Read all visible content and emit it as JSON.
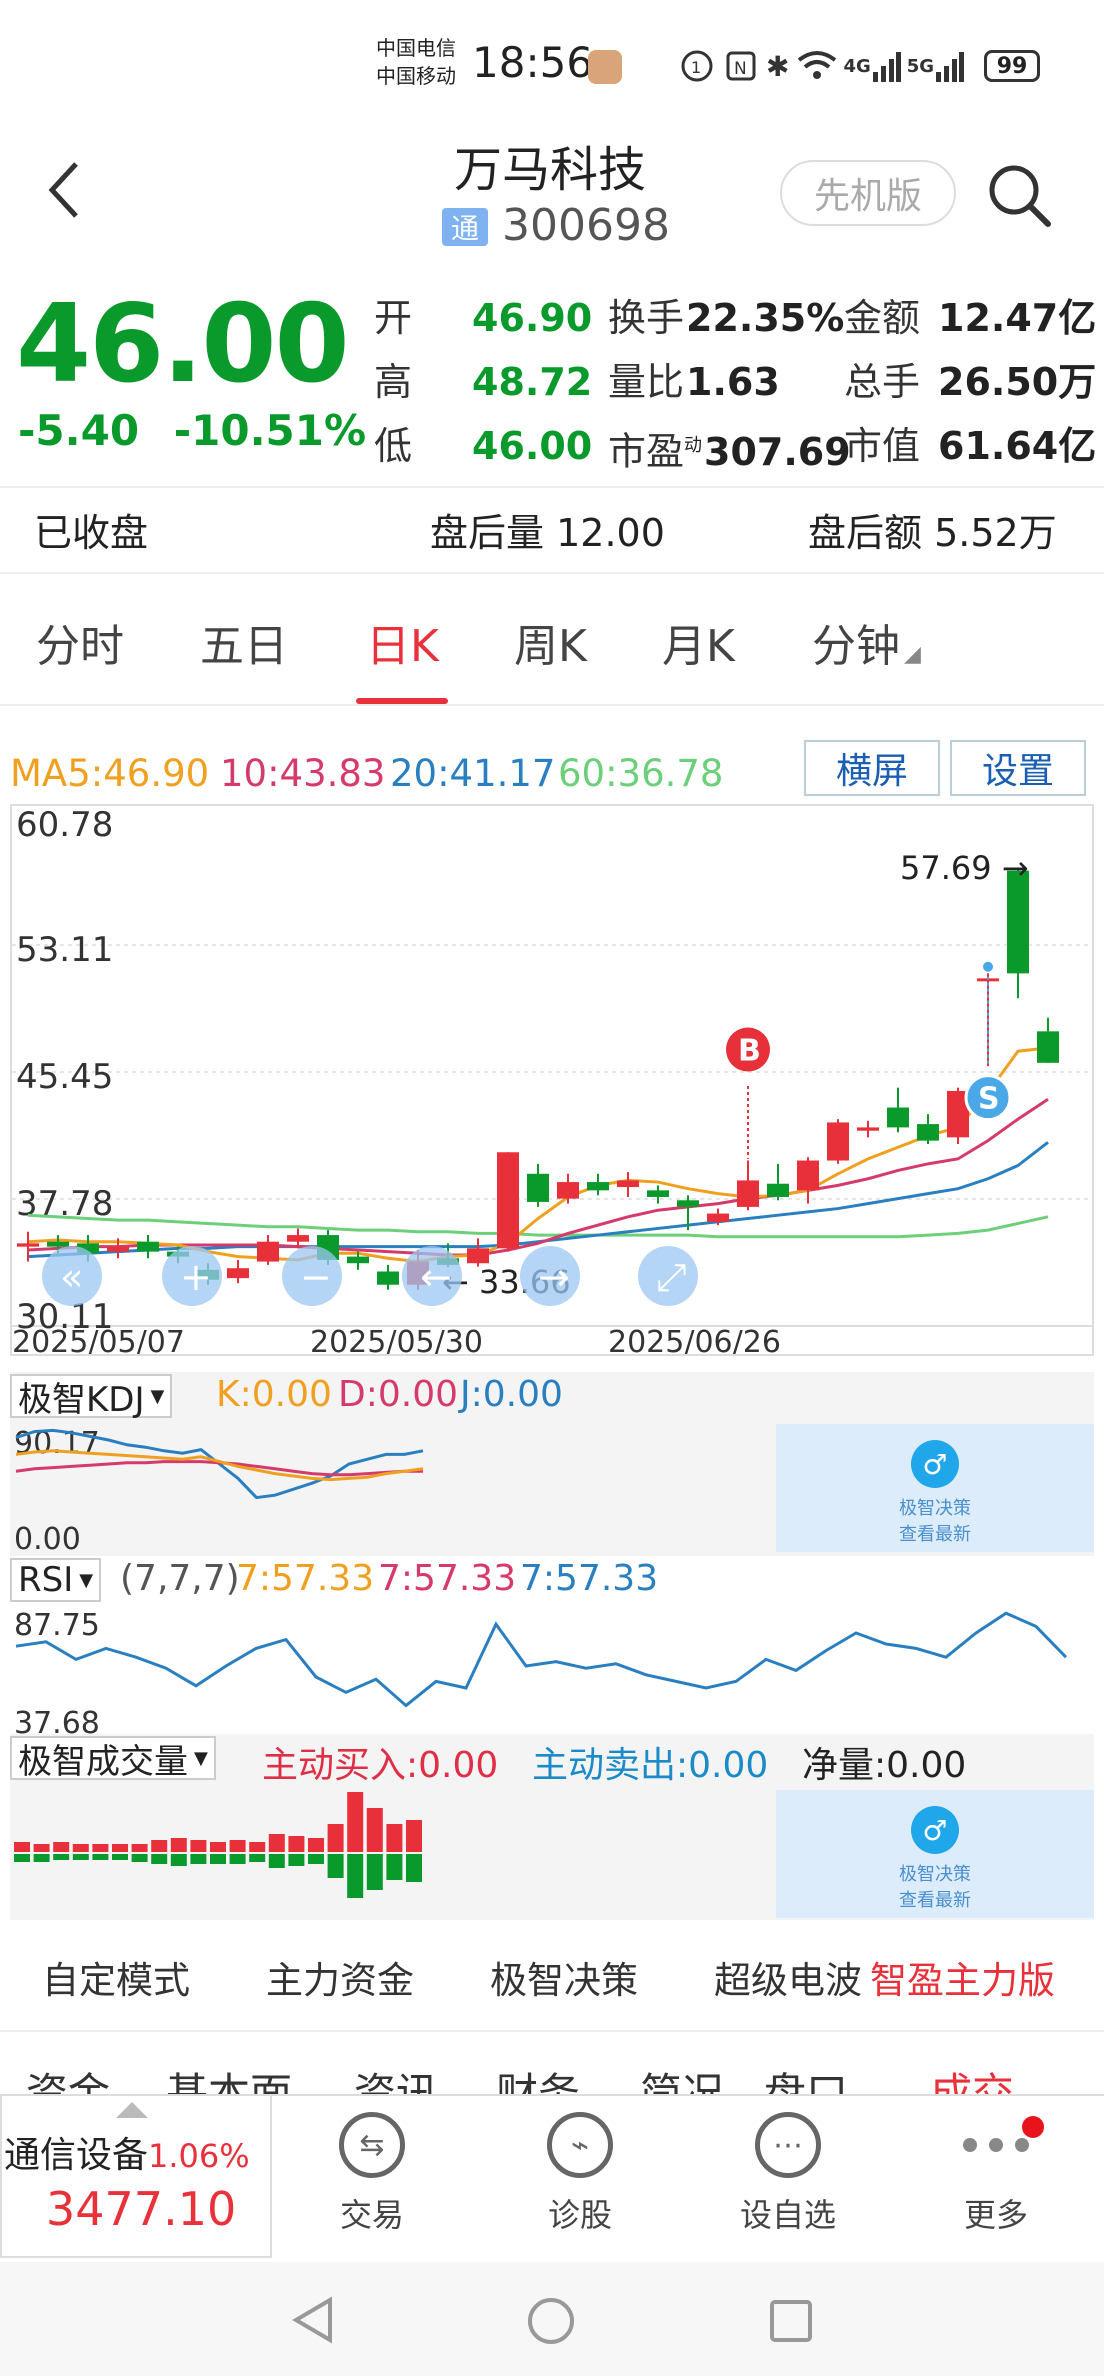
{
  "status_bar": {
    "carrier1": "中国电信",
    "carrier2": "中国移动",
    "time": "18:56",
    "network1": "4G",
    "network2": "5G",
    "battery": "99"
  },
  "header": {
    "title": "万马科技",
    "tag": "通",
    "code": "300698",
    "version_button": "先机版"
  },
  "quote": {
    "price": "46.00",
    "change": "-5.40",
    "change_pct": "-10.51%",
    "rows": [
      [
        {
          "l": "开",
          "v": "46.90",
          "c": "g"
        },
        {
          "l": "换手",
          "v": "22.35%",
          "c": "k"
        },
        {
          "l": "金额",
          "v": "12.47亿",
          "c": "k"
        }
      ],
      [
        {
          "l": "高",
          "v": "48.72",
          "c": "g"
        },
        {
          "l": "量比",
          "v": "1.63",
          "c": "k"
        },
        {
          "l": "总手",
          "v": "26.50万",
          "c": "k"
        }
      ],
      [
        {
          "l": "低",
          "v": "46.00",
          "c": "g"
        },
        {
          "l": "市盈",
          "v": "307.69",
          "c": "k"
        },
        {
          "l": "市值",
          "v": "61.64亿",
          "c": "k"
        }
      ]
    ],
    "pe_sup": "动",
    "closed": "已收盘",
    "after_vol_label": "盘后量",
    "after_vol": "12.00",
    "after_amt_label": "盘后额",
    "after_amt": "5.52万"
  },
  "tabs": [
    "分时",
    "五日",
    "日K",
    "周K",
    "月K",
    "分钟"
  ],
  "active_tab": "日K",
  "ma_legend": {
    "ma5": "MA5:46.90",
    "ma10": "10:43.83",
    "ma20": "20:41.17",
    "ma60": "60:36.78",
    "colors": {
      "ma5": "#f0a020",
      "ma10": "#d63a6a",
      "ma20": "#2a7fc0",
      "ma60": "#6ccf7a"
    }
  },
  "chart_buttons": {
    "landscape": "横屏",
    "settings": "设置"
  },
  "chart_data": {
    "type": "candlestick",
    "y_labels": [
      "60.78",
      "53.11",
      "45.45",
      "37.78",
      "30.11"
    ],
    "ylim": [
      30.11,
      60.78
    ],
    "x_labels": [
      "2025/05/07",
      "2025/05/30",
      "2025/06/26"
    ],
    "high_label": "57.69",
    "low_label": "33.66",
    "buy_marker": "B",
    "sell_marker": "S",
    "candles": [
      {
        "o": 34.9,
        "c": 35.1,
        "h": 35.8,
        "l": 34.0
      },
      {
        "o": 35.2,
        "c": 34.9,
        "h": 35.6,
        "l": 34.3
      },
      {
        "o": 35.1,
        "c": 34.5,
        "h": 35.6,
        "l": 34.0
      },
      {
        "o": 34.6,
        "c": 34.9,
        "h": 35.4,
        "l": 34.2
      },
      {
        "o": 35.2,
        "c": 34.6,
        "h": 35.6,
        "l": 34.2
      },
      {
        "o": 34.6,
        "c": 34.3,
        "h": 34.9,
        "l": 33.9
      },
      {
        "o": 33.5,
        "c": 32.9,
        "h": 33.9,
        "l": 32.6
      },
      {
        "o": 33.0,
        "c": 33.6,
        "h": 34.1,
        "l": 32.7
      },
      {
        "o": 34.0,
        "c": 35.2,
        "h": 35.6,
        "l": 33.8
      },
      {
        "o": 35.2,
        "c": 35.6,
        "h": 36.0,
        "l": 34.8
      },
      {
        "o": 35.6,
        "c": 34.1,
        "h": 35.9,
        "l": 33.8
      },
      {
        "o": 34.3,
        "c": 33.9,
        "h": 34.6,
        "l": 33.5
      },
      {
        "o": 33.4,
        "c": 32.6,
        "h": 33.8,
        "l": 32.3
      },
      {
        "o": 32.6,
        "c": 34.0,
        "h": 34.7,
        "l": 32.3
      },
      {
        "o": 34.2,
        "c": 33.8,
        "h": 35.1,
        "l": 33.66
      },
      {
        "o": 33.9,
        "c": 34.8,
        "h": 35.4,
        "l": 33.7
      },
      {
        "o": 34.8,
        "c": 40.6,
        "h": 40.6,
        "l": 34.6
      },
      {
        "o": 39.3,
        "c": 37.6,
        "h": 39.9,
        "l": 37.3
      },
      {
        "o": 37.8,
        "c": 38.8,
        "h": 39.3,
        "l": 37.5
      },
      {
        "o": 38.8,
        "c": 38.3,
        "h": 39.3,
        "l": 38.0
      },
      {
        "o": 38.5,
        "c": 38.9,
        "h": 39.4,
        "l": 37.9
      },
      {
        "o": 38.3,
        "c": 37.9,
        "h": 38.6,
        "l": 37.5
      },
      {
        "o": 37.7,
        "c": 37.3,
        "h": 38.0,
        "l": 35.9
      },
      {
        "o": 36.4,
        "c": 36.9,
        "h": 37.2,
        "l": 36.2
      },
      {
        "o": 37.3,
        "c": 38.9,
        "h": 40.1,
        "l": 37.1
      },
      {
        "o": 38.7,
        "c": 37.9,
        "h": 39.9,
        "l": 37.7
      },
      {
        "o": 38.3,
        "c": 40.1,
        "h": 40.3,
        "l": 37.5
      },
      {
        "o": 40.1,
        "c": 42.4,
        "h": 42.6,
        "l": 39.9
      },
      {
        "o": 41.9,
        "c": 42.1,
        "h": 42.5,
        "l": 41.5
      },
      {
        "o": 43.3,
        "c": 42.1,
        "h": 44.5,
        "l": 41.8
      },
      {
        "o": 42.3,
        "c": 41.3,
        "h": 42.9,
        "l": 41.1
      },
      {
        "o": 41.5,
        "c": 44.3,
        "h": 44.5,
        "l": 41.1
      },
      {
        "o": 51.1,
        "c": 51.1,
        "h": 51.4,
        "l": 45.8
      },
      {
        "o": 57.6,
        "c": 51.4,
        "h": 57.69,
        "l": 49.9
      },
      {
        "o": 47.9,
        "c": 46.0,
        "h": 48.72,
        "l": 46.0
      }
    ],
    "ma5": [
      35.2,
      35.3,
      35.2,
      35.2,
      35.1,
      35.0,
      34.6,
      34.3,
      34.2,
      34.1,
      34.5,
      34.5,
      34.2,
      34.0,
      34.3,
      34.4,
      35.1,
      36.6,
      37.9,
      38.6,
      38.9,
      38.8,
      38.4,
      38.1,
      37.9,
      38.0,
      38.3,
      39.3,
      40.2,
      40.9,
      41.6,
      42.1,
      44.2,
      46.7,
      46.9
    ],
    "ma10": [
      34.7,
      34.8,
      34.9,
      34.9,
      35.0,
      35.0,
      35.0,
      35.0,
      35.0,
      34.9,
      34.8,
      34.7,
      34.6,
      34.5,
      34.4,
      34.4,
      34.7,
      35.1,
      35.7,
      36.2,
      36.7,
      37.1,
      37.3,
      37.5,
      37.8,
      38.0,
      38.3,
      38.6,
      39.0,
      39.5,
      39.9,
      40.2,
      41.3,
      42.6,
      43.8
    ],
    "ma20": [
      34.3,
      34.4,
      34.5,
      34.6,
      34.7,
      34.8,
      34.8,
      34.9,
      34.9,
      34.9,
      34.9,
      34.9,
      34.9,
      34.9,
      34.9,
      34.9,
      35.0,
      35.2,
      35.4,
      35.6,
      35.8,
      36.0,
      36.2,
      36.4,
      36.6,
      36.8,
      37.0,
      37.2,
      37.5,
      37.8,
      38.1,
      38.4,
      39.0,
      39.8,
      41.2
    ],
    "ma60": [
      36.8,
      36.7,
      36.6,
      36.5,
      36.5,
      36.4,
      36.3,
      36.2,
      36.1,
      36.1,
      36.0,
      35.9,
      35.9,
      35.8,
      35.8,
      35.7,
      35.7,
      35.6,
      35.6,
      35.6,
      35.6,
      35.6,
      35.6,
      35.5,
      35.5,
      35.5,
      35.5,
      35.5,
      35.5,
      35.5,
      35.6,
      35.7,
      35.9,
      36.3,
      36.7
    ],
    "visible_dates": 35
  },
  "kdj": {
    "name": "极智KDJ",
    "k": "K:0.00",
    "d": "D:0.00",
    "j": "J:0.00",
    "top": "90.17",
    "bottom": "0.00",
    "k_vals": [
      78,
      80,
      81,
      80,
      79,
      78,
      77,
      76,
      75,
      74,
      76,
      72,
      68,
      65,
      62,
      60,
      58,
      57,
      58,
      59,
      62,
      64,
      66
    ],
    "d_vals": [
      64,
      66,
      67,
      68,
      69,
      70,
      71,
      71,
      72,
      72,
      72,
      71,
      70,
      68,
      66,
      64,
      62,
      61,
      61,
      62,
      63,
      64,
      64
    ],
    "j_vals": [
      92,
      97,
      98,
      96,
      93,
      90,
      86,
      84,
      81,
      79,
      82,
      70,
      58,
      42,
      44,
      49,
      54,
      60,
      70,
      74,
      78,
      78,
      81
    ]
  },
  "rsi": {
    "name": "RSI",
    "params": "(7,7,7)",
    "v1": "7:57.33",
    "v2": "7:57.33",
    "v3": "7:57.33",
    "top": "87.75",
    "bottom": "37.68",
    "vals": [
      76,
      78,
      70,
      75,
      71,
      66,
      58,
      67,
      75,
      79,
      62,
      55,
      61,
      49,
      60,
      57,
      86,
      67,
      69,
      66,
      68,
      63,
      60,
      57,
      60,
      70,
      65,
      74,
      82,
      77,
      75,
      71,
      82,
      91,
      85,
      71
    ]
  },
  "volume": {
    "name": "极智成交量",
    "buy": "主动买入:0.00",
    "sell": "主动卖出:0.00",
    "net": "净量:0.00",
    "up": [
      5,
      4,
      5,
      4,
      4,
      4,
      4,
      6,
      7,
      6,
      5,
      6,
      5,
      9,
      8,
      7,
      14,
      30,
      22,
      14,
      16
    ],
    "down": [
      4,
      4,
      3,
      3,
      3,
      3,
      4,
      5,
      6,
      5,
      5,
      5,
      4,
      7,
      6,
      5,
      12,
      22,
      18,
      13,
      14
    ]
  },
  "promo": {
    "line1": "极智决策",
    "line2": "查看最新"
  },
  "modes": [
    "自定模式",
    "主力资金",
    "极智决策",
    "超级电波"
  ],
  "modes_highlight": "智盈主力版",
  "lower_tabs": [
    "资金",
    "基本面",
    "资讯",
    "财务",
    "简况",
    "盘口",
    "成交"
  ],
  "index": {
    "name": "通信设备",
    "pct": "1.06%",
    "value": "3477.10"
  },
  "bottom_nav": [
    {
      "label": "交易",
      "icon": "trade-icon"
    },
    {
      "label": "诊股",
      "icon": "diagnose-icon"
    },
    {
      "label": "设自选",
      "icon": "watchlist-icon"
    },
    {
      "label": "更多",
      "icon": "more-icon"
    }
  ]
}
